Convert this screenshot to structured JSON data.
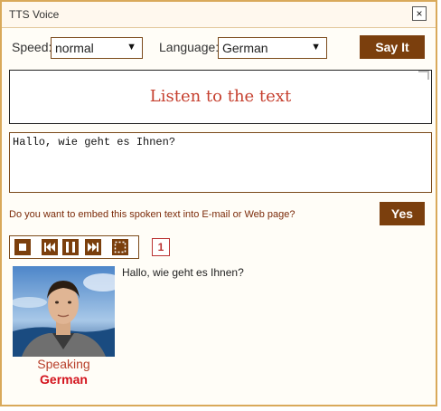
{
  "window": {
    "title": "TTS Voice",
    "close_label": "×"
  },
  "controls": {
    "speed_label": "Speed:",
    "speed_value": "normal",
    "language_label": "Language:",
    "language_value": "German",
    "say_it": "Say It"
  },
  "listen_text": "Listen to the text",
  "input_text": "Hallo, wie geht es Ihnen?",
  "embed": {
    "question": "Do you want to embed this spoken text into E-mail or Web page?",
    "yes": "Yes"
  },
  "player": {
    "page_number": "1",
    "icons": [
      "stop-icon",
      "rewind-icon",
      "pause-icon",
      "fast-forward-icon",
      "fullscreen-icon"
    ]
  },
  "speaker": {
    "status": "Speaking",
    "language": "German",
    "spoken_text": "Hallo, wie geht es Ihnen?"
  },
  "colors": {
    "accent": "#7b3f0d",
    "border": "#d9a95a",
    "heading_red": "#c6402f",
    "language_red": "#d3131d"
  }
}
